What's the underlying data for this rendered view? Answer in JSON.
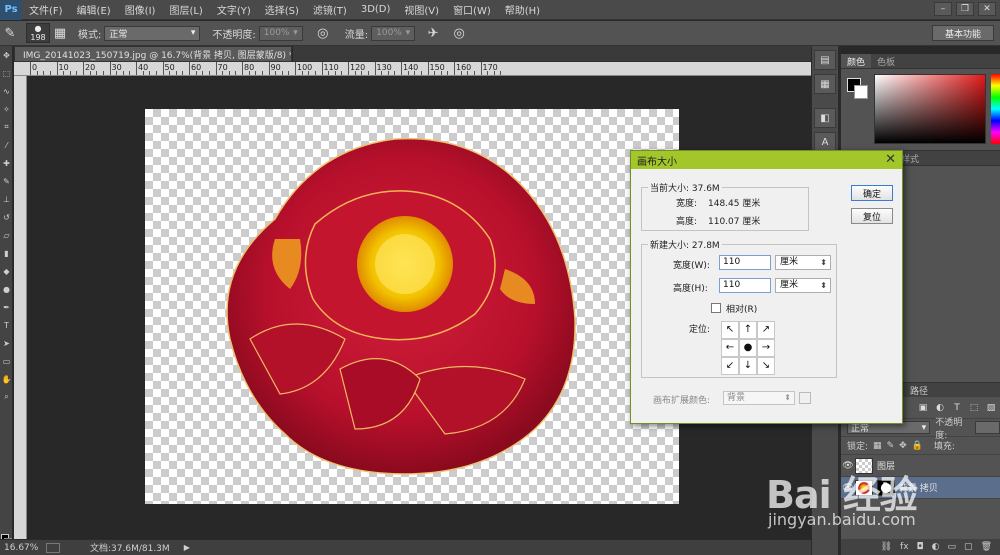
{
  "app": {
    "logo": "Ps"
  },
  "menu": [
    "文件(F)",
    "编辑(E)",
    "图像(I)",
    "图层(L)",
    "文字(Y)",
    "选择(S)",
    "滤镜(T)",
    "3D(D)",
    "视图(V)",
    "窗口(W)",
    "帮助(H)"
  ],
  "options_bar": {
    "brush_size": "198",
    "mode_label": "模式:",
    "mode_value": "正常",
    "opacity_label": "不透明度:",
    "opacity_value": "100%",
    "flow_label": "流量:",
    "flow_value": "100%",
    "workspace": "基本功能"
  },
  "document": {
    "tab_title": "IMG_20141023_150719.jpg @ 16.7%(背景 拷贝, 图层蒙版/8) *",
    "close": "×",
    "ruler_top": [
      "0",
      "10",
      "20",
      "30",
      "40",
      "50",
      "60",
      "70",
      "80",
      "90",
      "100",
      "110",
      "120",
      "130",
      "140",
      "150",
      "160",
      "170"
    ]
  },
  "status": {
    "zoom": "16.67%",
    "doc_info": "文档:37.6M/81.3M",
    "arrow": "▶"
  },
  "panels": {
    "color_tabs": [
      "颜色",
      "色板"
    ],
    "styles_tab": "样式",
    "layers_tab": "路径",
    "blend_mode": "正常",
    "opacity_label": "不透明度:",
    "lock_label": "锁定:",
    "fill_label": "填充:",
    "layers": [
      {
        "name": "图层",
        "selected": false
      },
      {
        "name": "背景 拷贝",
        "selected": true
      }
    ]
  },
  "dialog": {
    "title": "画布大小",
    "current_size_label": "当前大小: 37.6M",
    "current_width_label": "宽度:",
    "current_width_value": "148.45 厘米",
    "current_height_label": "高度:",
    "current_height_value": "110.07 厘米",
    "new_size_label": "新建大小: 27.8M",
    "width_label": "宽度(W):",
    "width_value": "110",
    "width_unit": "厘米",
    "height_label": "高度(H):",
    "height_value": "110",
    "height_unit": "厘米",
    "relative_label": "相对(R)",
    "anchor_label": "定位:",
    "ok_button": "确定",
    "reset_button": "复位",
    "ext_color_label": "画布扩展颜色:",
    "ext_color_value": "背景",
    "anchors": [
      "↖",
      "↑",
      "↗",
      "←",
      "●",
      "→",
      "↙",
      "↓",
      "↘"
    ]
  },
  "watermark": {
    "logo": "Bai 经验",
    "url": "jingyan.baidu.com"
  }
}
